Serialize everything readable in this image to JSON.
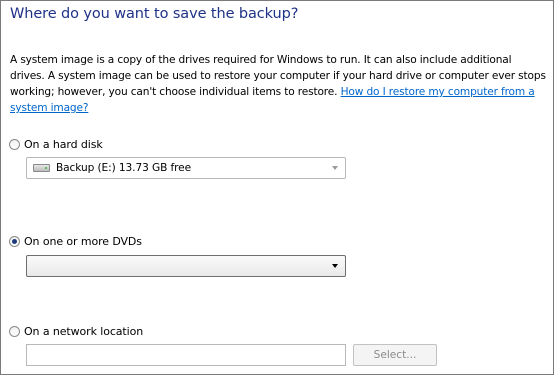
{
  "header": {
    "title": "Where do you want to save the backup?"
  },
  "description": {
    "text": "A system image is a copy of the drives required for Windows to run. It can also include additional drives. A system image can be used to restore your computer if your hard drive or computer ever stops working; however, you can't choose individual items to restore. ",
    "link": "How do I restore my computer from a system image?"
  },
  "options": {
    "hard_disk": {
      "label": "On a hard disk",
      "selected": false,
      "value": "Backup (E:)  13.73 GB free"
    },
    "dvds": {
      "label": "On one or more DVDs",
      "selected": true,
      "value": ""
    },
    "network": {
      "label": "On a network location",
      "selected": false,
      "path": "",
      "select_button": "Select..."
    }
  },
  "colors": {
    "title": "#1e3287",
    "link": "#0066cc"
  }
}
